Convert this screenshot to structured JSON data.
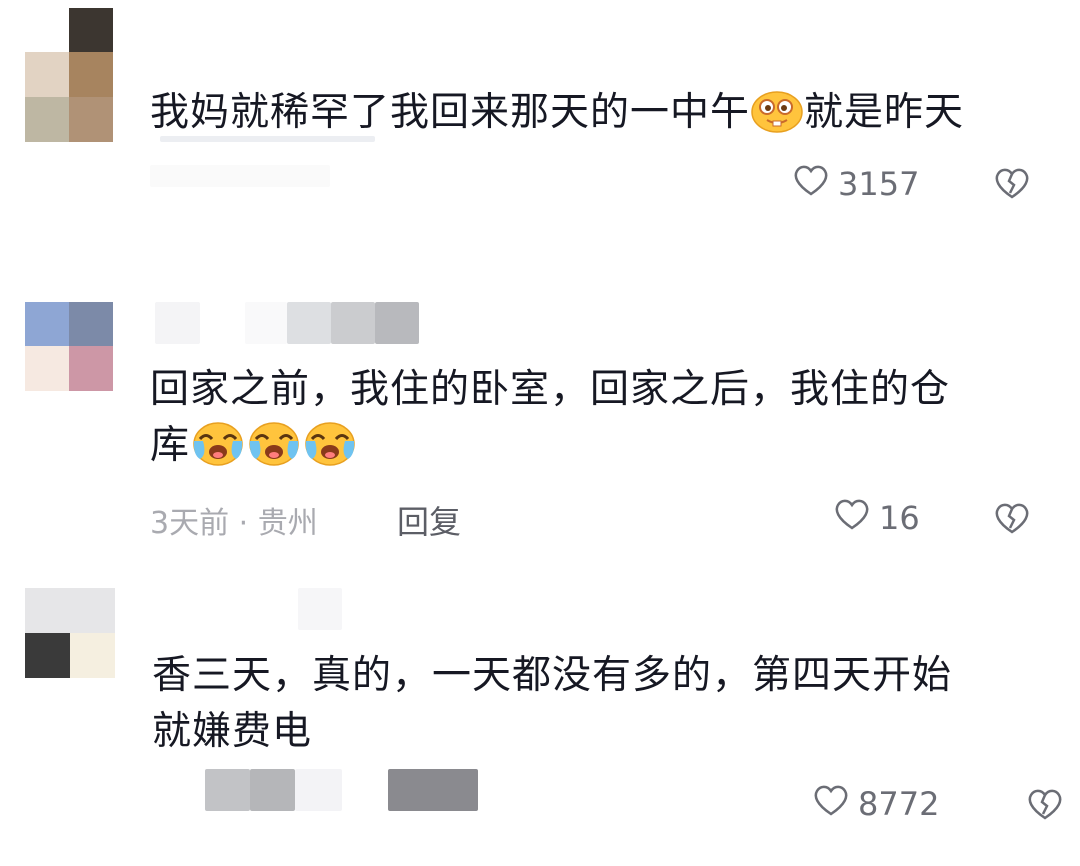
{
  "comments": [
    {
      "text": "我妈就稀罕了我回来那天的一中午",
      "emoji": "grimace-emoji",
      "text_after": "就是昨天",
      "likes": "3157"
    },
    {
      "text_line1": "回家之前，我住的卧室，回家之后，我住的仓",
      "text_line2": "库",
      "emoji": "crying-emoji",
      "time_location": "3天前 · 贵州",
      "reply_label": "回复",
      "likes": "16"
    },
    {
      "text_line1": "香三天，真的，一天都没有多的，第四天开始",
      "text_line2": "就嫌费电",
      "likes": "8772"
    }
  ],
  "icons": {
    "like": "heart-outline-icon",
    "dislike": "broken-heart-icon"
  },
  "colors": {
    "text": "#161823",
    "meta": "#a9aab0",
    "icon": "#6b6d75"
  }
}
